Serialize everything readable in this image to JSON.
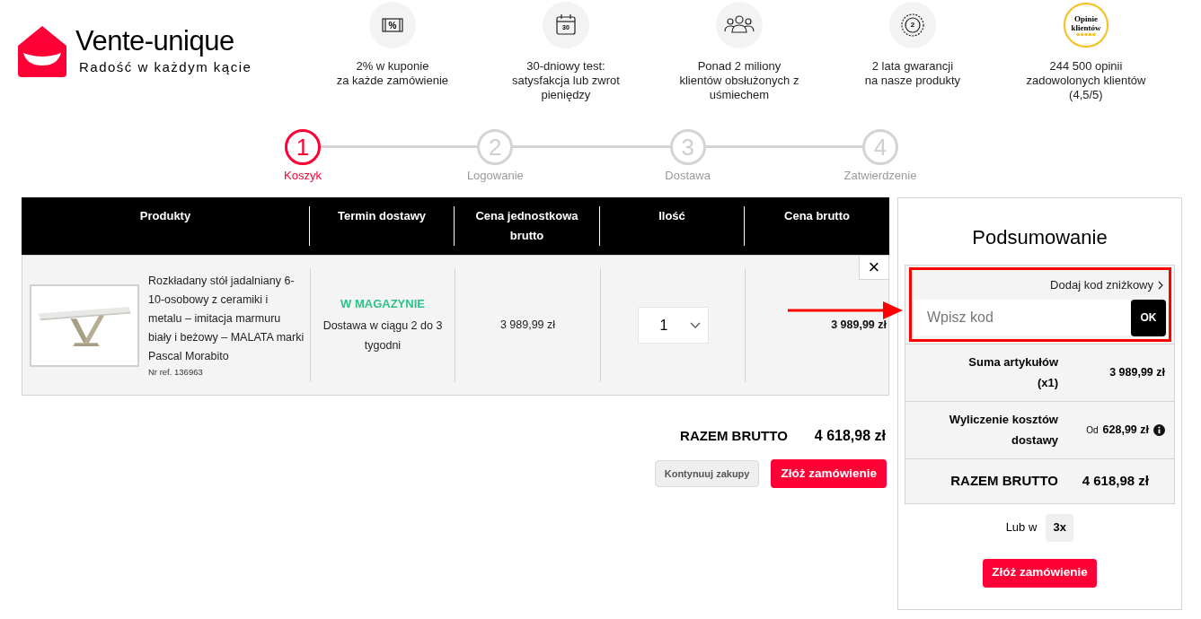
{
  "logo": {
    "name": "Vente-unique",
    "tagline": "Radość w każdym kącie"
  },
  "features": [
    {
      "kind": "coupon",
      "icon_text": "%",
      "text": "2% w kuponie\nza każde zamówienie"
    },
    {
      "kind": "calendar",
      "icon_text": "30",
      "text": "30-dniowy test:\nsatysfakcja lub zwrot\npieniędzy"
    },
    {
      "kind": "people",
      "text": "Ponad 2 miliony\nklientów obsłużonych z\nuśmiechem"
    },
    {
      "kind": "seal",
      "icon_text": "2",
      "text": "2 lata gwarancji\nna nasze produkty"
    },
    {
      "kind": "reviews",
      "icon_text": "Opinie\nklientów",
      "text": "244 500 opinii\nzadowolonych klientów\n(4,5/5)"
    }
  ],
  "steps": [
    {
      "number": "1",
      "label": "Koszyk",
      "selected": true
    },
    {
      "number": "2",
      "label": "Logowanie",
      "selected": false
    },
    {
      "number": "3",
      "label": "Dostawa",
      "selected": false
    },
    {
      "number": "4",
      "label": "Zatwierdzenie",
      "selected": false
    }
  ],
  "table": {
    "columns": [
      "Produkty",
      "Termin dostawy",
      "Cena jednostkowa brutto",
      "Ilość",
      "Cena brutto"
    ],
    "rows": [
      {
        "name": "Rozkładany stół jadalniany 6-10-osobowy z ceramiki i metalu – imitacja marmuru biały i beżowy – MALATA marki Pascal Morabito",
        "ref": "Nr ref. 136963",
        "stock": "W MAGAZYNIE",
        "delivery": "Dostawa w ciągu 2 do 3 tygodni",
        "unit_price": "3 989,99 zł",
        "quantity": "1",
        "total": "3 989,99 zł",
        "remove": "×"
      }
    ]
  },
  "totals": {
    "label": "RAZEM BRUTTO",
    "value": "4 618,98 zł"
  },
  "buttons": {
    "continue": "Kontynuuj zakupy",
    "order": "Złóż zamówienie"
  },
  "summary": {
    "title": "Podsumowanie",
    "discount_link": "Dodaj kod zniżkowy",
    "code_placeholder": "Wpisz kod",
    "code_button": "OK",
    "lines": [
      {
        "kind": "plain",
        "label": "Suma artykułów\n(x1)",
        "value": "3 989,99 zł"
      },
      {
        "kind": "shipping",
        "label": "Wyliczenie kosztów\ndostawy",
        "prefix": "Od",
        "value": "628,99 zł"
      },
      {
        "kind": "total",
        "label": "RAZEM BRUTTO",
        "value": "4 618,98 zł"
      }
    ],
    "installments_label": "Lub w",
    "installments": "3x",
    "order_button": "Złóż zamówienie"
  }
}
